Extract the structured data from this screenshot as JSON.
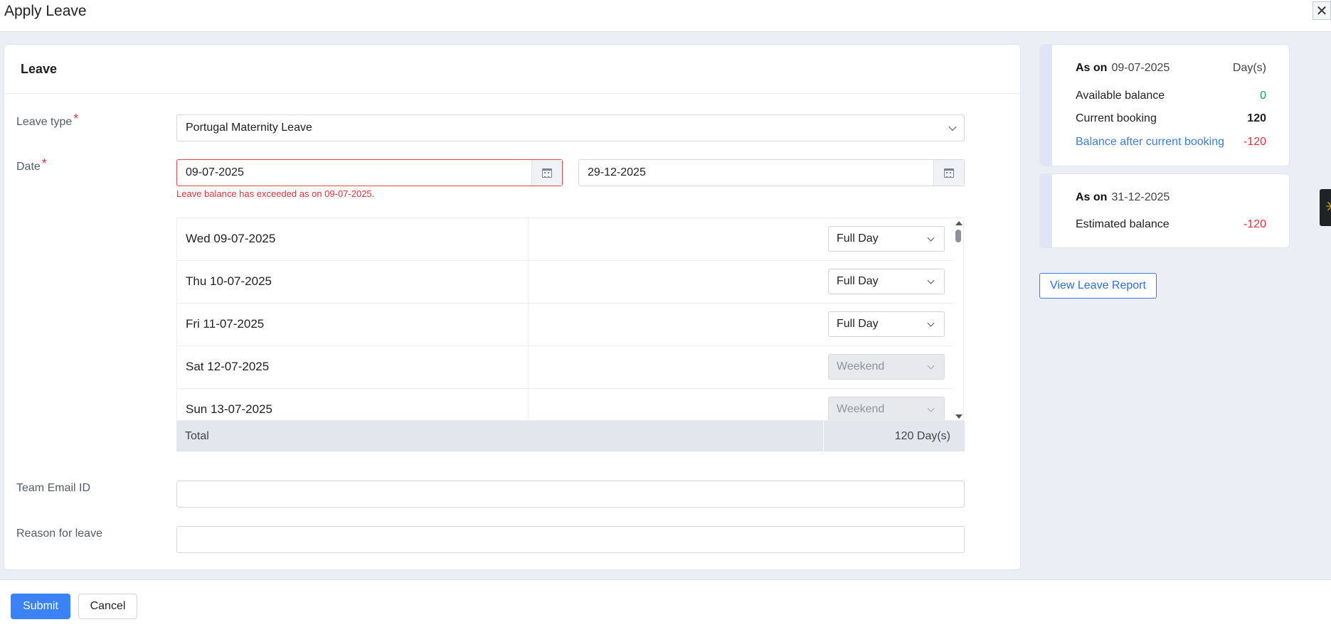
{
  "header": {
    "title": "Apply Leave",
    "close_icon": "close-icon",
    "close_glyph": "✕"
  },
  "form": {
    "section_title": "Leave",
    "leave_type": {
      "label": "Leave type",
      "required_mark": "*",
      "value": "Portugal Maternity Leave"
    },
    "date": {
      "label": "Date",
      "required_mark": "*",
      "from": "09-07-2025",
      "to": "29-12-2025",
      "error": "Leave balance has exceeded as on 09-07-2025."
    },
    "days": [
      {
        "date": "Wed 09-07-2025",
        "type": "Full Day",
        "disabled": false
      },
      {
        "date": "Thu 10-07-2025",
        "type": "Full Day",
        "disabled": false
      },
      {
        "date": "Fri 11-07-2025",
        "type": "Full Day",
        "disabled": false
      },
      {
        "date": "Sat 12-07-2025",
        "type": "Weekend",
        "disabled": true
      },
      {
        "date": "Sun 13-07-2025",
        "type": "Weekend",
        "disabled": true
      }
    ],
    "total": {
      "label": "Total",
      "value": "120 Day(s)"
    },
    "team_email": {
      "label": "Team Email ID",
      "value": ""
    },
    "reason": {
      "label": "Reason for leave",
      "value": ""
    }
  },
  "balance_current": {
    "as_on_label": "As on",
    "as_on_date": "09-07-2025",
    "unit": "Day(s)",
    "rows": [
      {
        "label": "Available balance",
        "value": "0",
        "color": "#22a34a"
      },
      {
        "label": "Current booking",
        "value": "120",
        "color": "#222222"
      },
      {
        "label": "Balance after current booking",
        "value": "-120",
        "color": "#e0343b"
      }
    ]
  },
  "balance_future": {
    "as_on_label": "As on",
    "as_on_date": "31-12-2025",
    "rows": [
      {
        "label": "Estimated balance",
        "value": "-120",
        "color": "#e0343b"
      }
    ]
  },
  "view_report_label": "View Leave Report",
  "footer": {
    "submit_label": "Submit",
    "cancel_label": "Cancel"
  },
  "colors": {
    "primary": "#3b82f6",
    "error": "#e0343b",
    "success": "#22a34a",
    "link": "#3b7de3"
  }
}
